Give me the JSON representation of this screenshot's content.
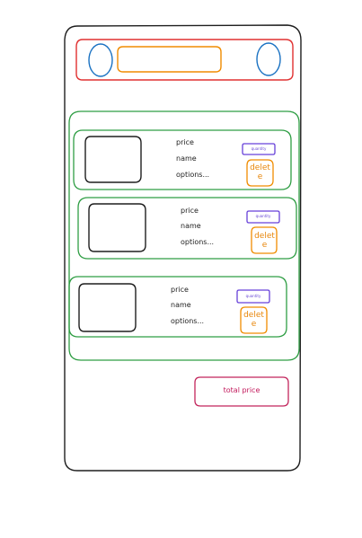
{
  "cart_items": [
    {
      "price_label": "price",
      "name_label": "name",
      "options_label": "options...",
      "quantity_label": "quantity",
      "delete_label": "delete"
    },
    {
      "price_label": "price",
      "name_label": "name",
      "options_label": "options...",
      "quantity_label": "quantity",
      "delete_label": "delete"
    },
    {
      "price_label": "price",
      "name_label": "name",
      "options_label": "options...",
      "quantity_label": "quantity",
      "delete_label": "delete"
    }
  ],
  "footer": {
    "total_price_label": "total price"
  },
  "colors": {
    "outline": "#1e1e1e",
    "header": "#e03131",
    "header_button": "#1971c2",
    "search": "#f08c00",
    "item_list": "#2f9e44",
    "quantity": "#6741d9",
    "delete": "#f08c00",
    "total": "#c2255c"
  }
}
